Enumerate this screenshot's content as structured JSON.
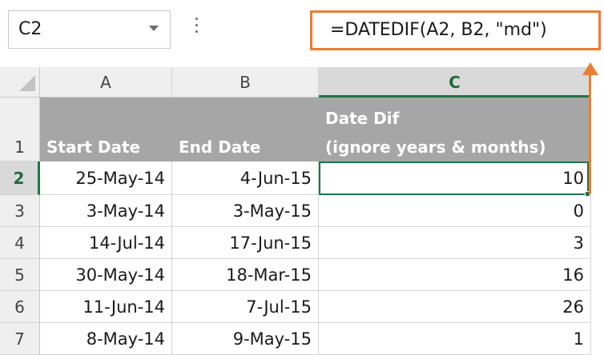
{
  "name_box": {
    "value": "C2"
  },
  "formula_bar": {
    "value": "=DATEDIF(A2, B2, \"md\")"
  },
  "columns": [
    "A",
    "B",
    "C"
  ],
  "rows": [
    "1",
    "2",
    "3",
    "4",
    "5",
    "6",
    "7"
  ],
  "headers": {
    "a": "Start Date",
    "b": "End Date",
    "c_line1": "Date Dif",
    "c_line2": "(ignore years & months)"
  },
  "data": [
    {
      "start": "25-May-14",
      "end": "4-Jun-15",
      "dif": "10"
    },
    {
      "start": "3-May-14",
      "end": "3-May-15",
      "dif": "0"
    },
    {
      "start": "14-Jul-14",
      "end": "17-Jun-15",
      "dif": "3"
    },
    {
      "start": "30-May-14",
      "end": "18-Mar-15",
      "dif": "16"
    },
    {
      "start": "11-Jun-14",
      "end": "7-Jul-15",
      "dif": "26"
    },
    {
      "start": "8-May-14",
      "end": "9-May-15",
      "dif": "1"
    }
  ],
  "colors": {
    "accent": "#ed7d31",
    "selection": "#217346",
    "header_fill": "#a6a6a6"
  },
  "icons": [
    "dropdown-arrow-icon",
    "more-options-icon",
    "select-all-icon",
    "callout-arrow-icon"
  ]
}
